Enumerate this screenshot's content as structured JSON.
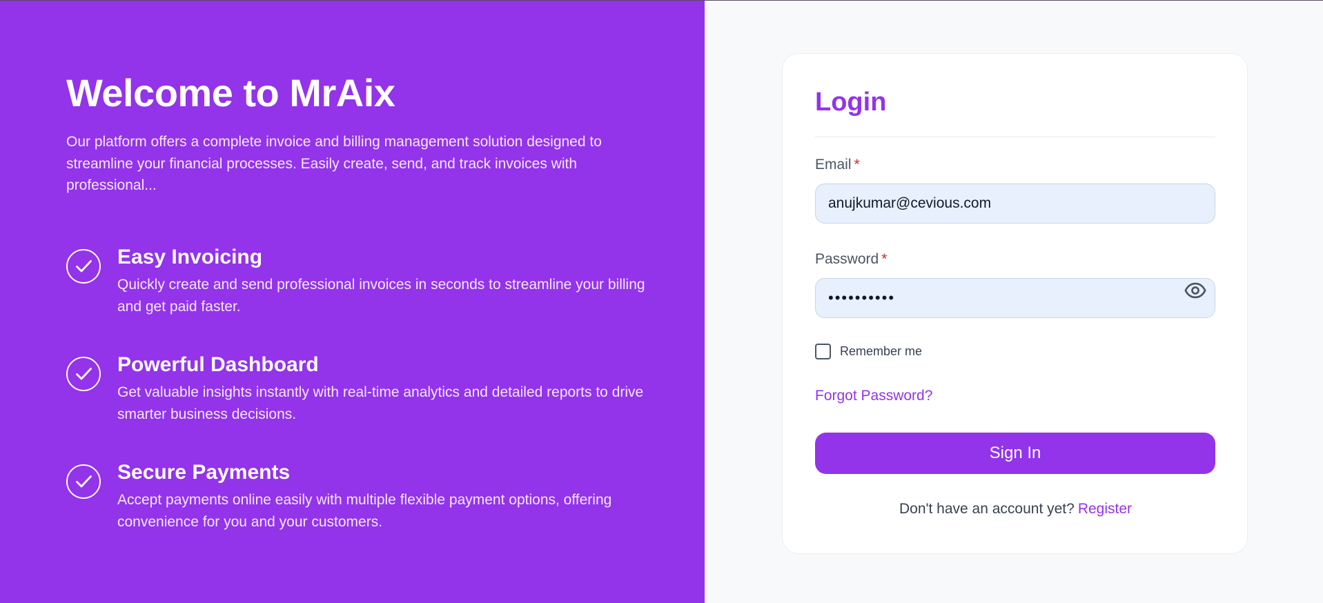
{
  "colors": {
    "brand": "#9333ea",
    "panel_bg": "#f8f9fa",
    "input_bg": "#e8f0fe",
    "required": "#dc2626"
  },
  "hero": {
    "title": "Welcome to MrAix",
    "description": "Our platform offers a complete invoice and billing management solution designed to streamline your financial processes. Easily create, send, and track invoices with professional..."
  },
  "features": [
    {
      "icon": "check-circle-icon",
      "title": "Easy Invoicing",
      "description": "Quickly create and send professional invoices in seconds to streamline your billing and get paid faster."
    },
    {
      "icon": "check-circle-icon",
      "title": "Powerful Dashboard",
      "description": "Get valuable insights instantly with real-time analytics and detailed reports to drive smarter business decisions."
    },
    {
      "icon": "check-circle-icon",
      "title": "Secure Payments",
      "description": "Accept payments online easily with multiple flexible payment options, offering convenience for you and your customers."
    }
  ],
  "login": {
    "title": "Login",
    "email_label": "Email",
    "email_value": "anujkumar@cevious.com",
    "password_label": "Password",
    "password_value": "••••••••••",
    "required_mark": "*",
    "toggle_icon": "eye-icon",
    "remember_label": "Remember me",
    "remember_checked": false,
    "forgot_label": "Forgot Password?",
    "signin_label": "Sign In",
    "no_account_text": "Don't have an account yet?",
    "register_label": "Register"
  }
}
